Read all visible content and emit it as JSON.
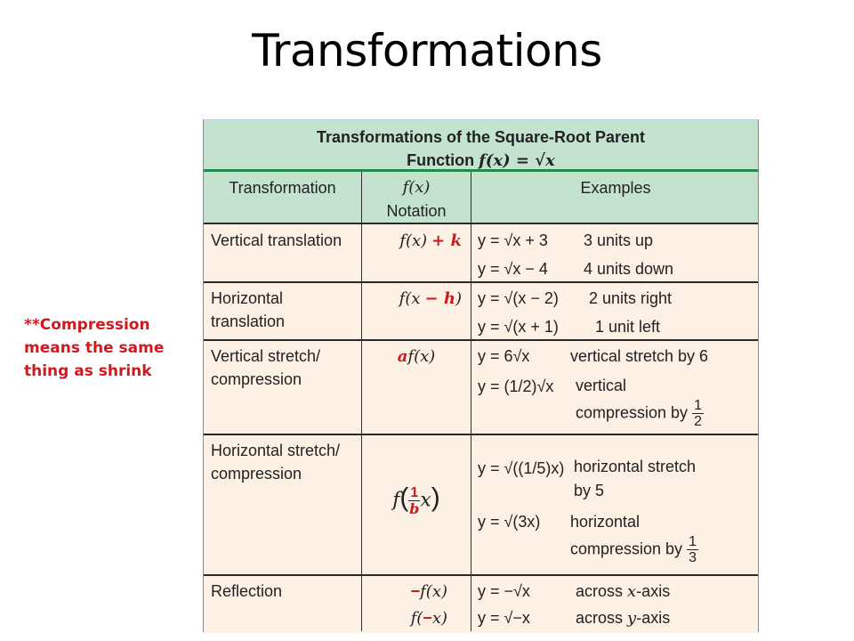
{
  "slide": {
    "title": "Transformations",
    "note": "**Compression means the same thing as shrink"
  },
  "table": {
    "caption_line1": "Transformations of the Square-Root Parent",
    "caption_line2_prefix": "Function ",
    "caption_line2_math": "f(x) = √x",
    "headers": {
      "transformation": "Transformation",
      "notation_line1": "f(x)",
      "notation_line2": "Notation",
      "examples": "Examples"
    },
    "rows": [
      {
        "transformation": "Vertical translation",
        "notation": {
          "base": "f(x)",
          "red": "+ k"
        },
        "examples": [
          {
            "equation": "y = √x + 3",
            "description": "3 units up"
          },
          {
            "equation": "y = √x − 4",
            "description": "4 units down"
          }
        ]
      },
      {
        "transformation": "Horizontal translation",
        "notation": {
          "base": "f(x",
          "red": "− h",
          "close": ")"
        },
        "examples": [
          {
            "equation": "y = √(x − 2)",
            "description": "2 units right"
          },
          {
            "equation": "y = √(x + 1)",
            "description": "1 unit left"
          }
        ]
      },
      {
        "transformation": "Vertical stretch/ compression",
        "notation": {
          "red": "a",
          "base": "f(x)"
        },
        "examples": [
          {
            "equation": "y = 6√x",
            "description": "vertical stretch by 6"
          },
          {
            "equation": "y = (1/2)√x",
            "description": "vertical compression by 1/2",
            "desc_line1": "vertical",
            "desc_line2": "compression by",
            "frac_num": "1",
            "frac_den": "2"
          }
        ]
      },
      {
        "transformation": "Horizontal stretch/ compression",
        "notation": {
          "base": "f",
          "frac_num": "1",
          "frac_den": "b",
          "after": "x"
        },
        "examples": [
          {
            "equation": "y = √((1/5)x)",
            "description": "horizontal stretch by 5",
            "desc_line1": "horizontal stretch",
            "desc_line2": "by 5",
            "frac_num": "1",
            "frac_den": "5"
          },
          {
            "equation": "y = √(3x)",
            "description": "horizontal compression by 1/3",
            "desc_line1": "horizontal",
            "desc_line2": "compression by",
            "frac_num": "1",
            "frac_den": "3"
          }
        ]
      },
      {
        "transformation": "Reflection",
        "notations": [
          {
            "red": "−",
            "base": "f(x)"
          },
          {
            "base": "f(",
            "red": "−",
            "close": "x)"
          }
        ],
        "examples": [
          {
            "equation": "y = −√x",
            "description": "across x-axis",
            "desc_prefix": "across ",
            "desc_var": "x",
            "desc_suffix": "-axis"
          },
          {
            "equation": "y = √−x",
            "description": "across y-axis",
            "desc_prefix": "across ",
            "desc_var": "y",
            "desc_suffix": "-axis"
          }
        ]
      }
    ]
  },
  "colors": {
    "header_green": "#c3e3cf",
    "rule_green": "#1f8a4c",
    "body_cream": "#fdf0e4",
    "accent_red": "#d0181f"
  }
}
